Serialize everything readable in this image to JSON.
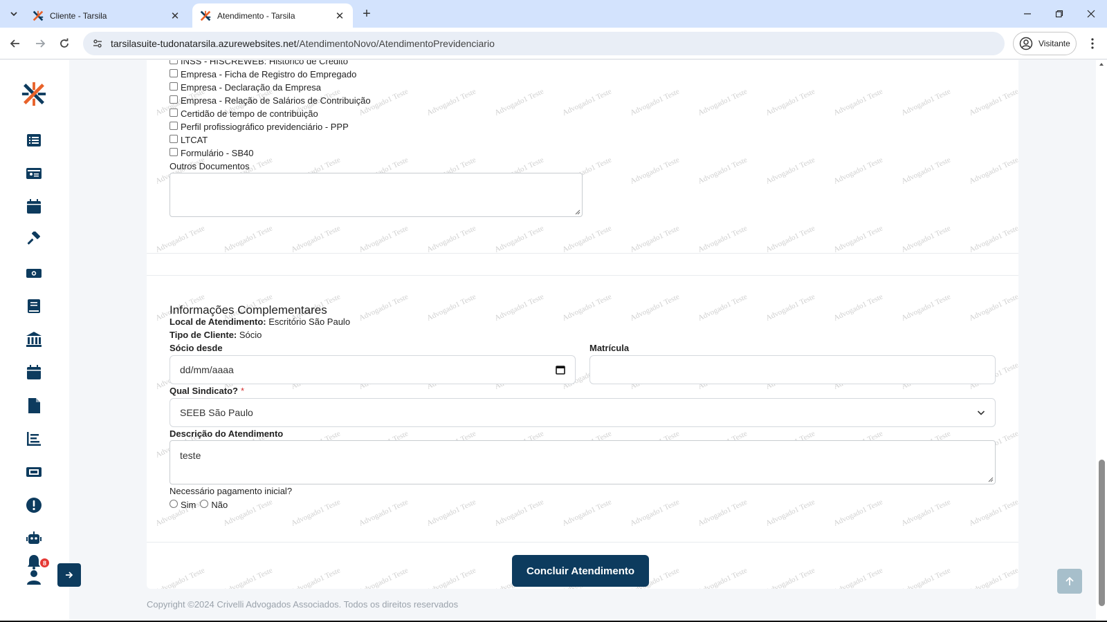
{
  "browser": {
    "tabs": [
      {
        "title": "Cliente - Tarsila",
        "active": false
      },
      {
        "title": "Atendimento - Tarsila",
        "active": true
      }
    ],
    "url_host": "tarsilasuite-tudonatarsila.azurewebsites.net",
    "url_path": "/AtendimentoNovo/AtendimentoPrevidenciario",
    "profile_label": "Visitante"
  },
  "sidebar": {
    "icons": [
      "list-icon",
      "id-card-icon",
      "calendar-icon",
      "gavel-icon",
      "money-icon",
      "book-icon",
      "bank-icon",
      "calendar-icon",
      "file-icon",
      "chart-icon",
      "ticket-icon",
      "alert-icon",
      "robot-icon",
      "bell-icon",
      "user-icon"
    ],
    "notification_count": "8"
  },
  "documents": {
    "checkboxes": [
      "INSS - HISCREWEB: Histórico de Crédito",
      "Empresa - Ficha de Registro do Empregado",
      "Empresa - Declaração da Empresa",
      "Empresa - Relação de Salários de Contribuição",
      "Certidão de tempo de contribuição",
      "Perfil profissiográfico previdenciário - PPP",
      "LTCAT",
      "Formulário - SB40"
    ],
    "outros_label": "Outros Documentos",
    "outros_value": ""
  },
  "complementares": {
    "title": "Informações Complementares",
    "local_label": "Local de Atendimento:",
    "local_value": "Escritório São Paulo",
    "tipo_label": "Tipo de Cliente:",
    "tipo_value": "Sócio",
    "socio_desde_label": "Sócio desde",
    "socio_desde_placeholder": "dd/mm/aaaa",
    "matricula_label": "Matrícula",
    "matricula_value": "",
    "sindicato_label": "Qual Sindicato?",
    "sindicato_required": "*",
    "sindicato_value": "SEEB São Paulo",
    "descricao_label": "Descrição do Atendimento",
    "descricao_value": "teste",
    "pagamento_label": "Necessário pagamento inicial?",
    "pagamento_options": [
      "Sim",
      "Não"
    ]
  },
  "actions": {
    "submit_label": "Concluir Atendimento"
  },
  "watermark_text": "Advogado1 Teste",
  "footer": {
    "copyright": "Copyright ©2024 Crivelli Advogados Associados. Todos os direitos reservados"
  },
  "colors": {
    "primary": "#0d3b5e",
    "logo_orange": "#e8622a",
    "logo_navy": "#0d3b5e",
    "badge_red": "#e53935"
  }
}
